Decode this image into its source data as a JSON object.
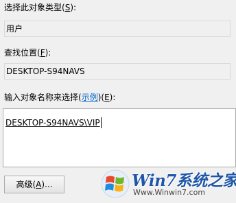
{
  "object_type": {
    "label_prefix": "选择此对象类型(",
    "label_key": "S",
    "label_suffix": "):",
    "value": "用户"
  },
  "location": {
    "label_prefix": "查找位置(",
    "label_key": "F",
    "label_suffix": "):",
    "value": "DESKTOP-S94NAVS"
  },
  "object_names": {
    "label_prefix": "输入对象名称来选择(",
    "label_link": "示例",
    "label_suffix": ")(",
    "label_key": "E",
    "label_end": "):",
    "value": "DESKTOP-S94NAVS\\VIP"
  },
  "advanced_button": {
    "label_prefix": "高级(",
    "label_key": "A",
    "label_suffix": ")..."
  },
  "watermark": {
    "title": "Win7系统之家",
    "url": "Www.Winwin7.com"
  }
}
